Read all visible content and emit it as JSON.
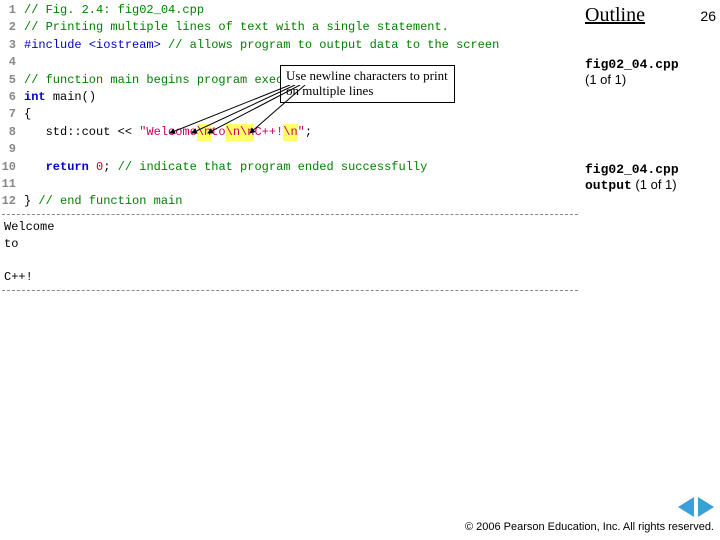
{
  "header": {
    "outline": "Outline",
    "page_number": "26"
  },
  "callout": {
    "text": "Use newline characters to print on multiple lines"
  },
  "right": {
    "file_caption": "fig02_04.cpp",
    "file_count": "(1 of 1)",
    "out_caption_mono": "fig02_04.cpp output",
    "out_caption_rest": " (1 of 1)"
  },
  "code": {
    "l1": {
      "n": "1",
      "a": "// Fig. 2.4: fig02_04.cpp"
    },
    "l2": {
      "n": "2",
      "a": "// Printing multiple lines of text with a single statement."
    },
    "l3": {
      "n": "3",
      "a": "#include ",
      "b": "<iostream>",
      "c": " // allows program to output data to the screen"
    },
    "l4": {
      "n": "4",
      "a": ""
    },
    "l5": {
      "n": "5",
      "a": "// function main begins program execution"
    },
    "l6": {
      "n": "6",
      "a": "int ",
      "b": "main()"
    },
    "l7": {
      "n": "7",
      "a": "{"
    },
    "l8": {
      "n": "8",
      "a": "   std::cout << ",
      "s1": "\"Welcome",
      "h1": "\\n",
      "s2": "to",
      "h2": "\\n\\n",
      "s3": "C++!",
      "h3": "\\n",
      "s4": "\"",
      "tail": ";"
    },
    "l9": {
      "n": "9",
      "a": ""
    },
    "l10": {
      "n": "10",
      "a": "   ",
      "b": "return ",
      "c": "0",
      "d": "; ",
      "e": "// indicate that program ended successfully"
    },
    "l11": {
      "n": "11",
      "a": ""
    },
    "l12": {
      "n": "12",
      "a": "} ",
      "b": "// end function main"
    }
  },
  "output_text": "Welcome\nto\n\nC++!",
  "footer": {
    "copyright": "© 2006 Pearson Education, Inc.  All rights reserved."
  }
}
